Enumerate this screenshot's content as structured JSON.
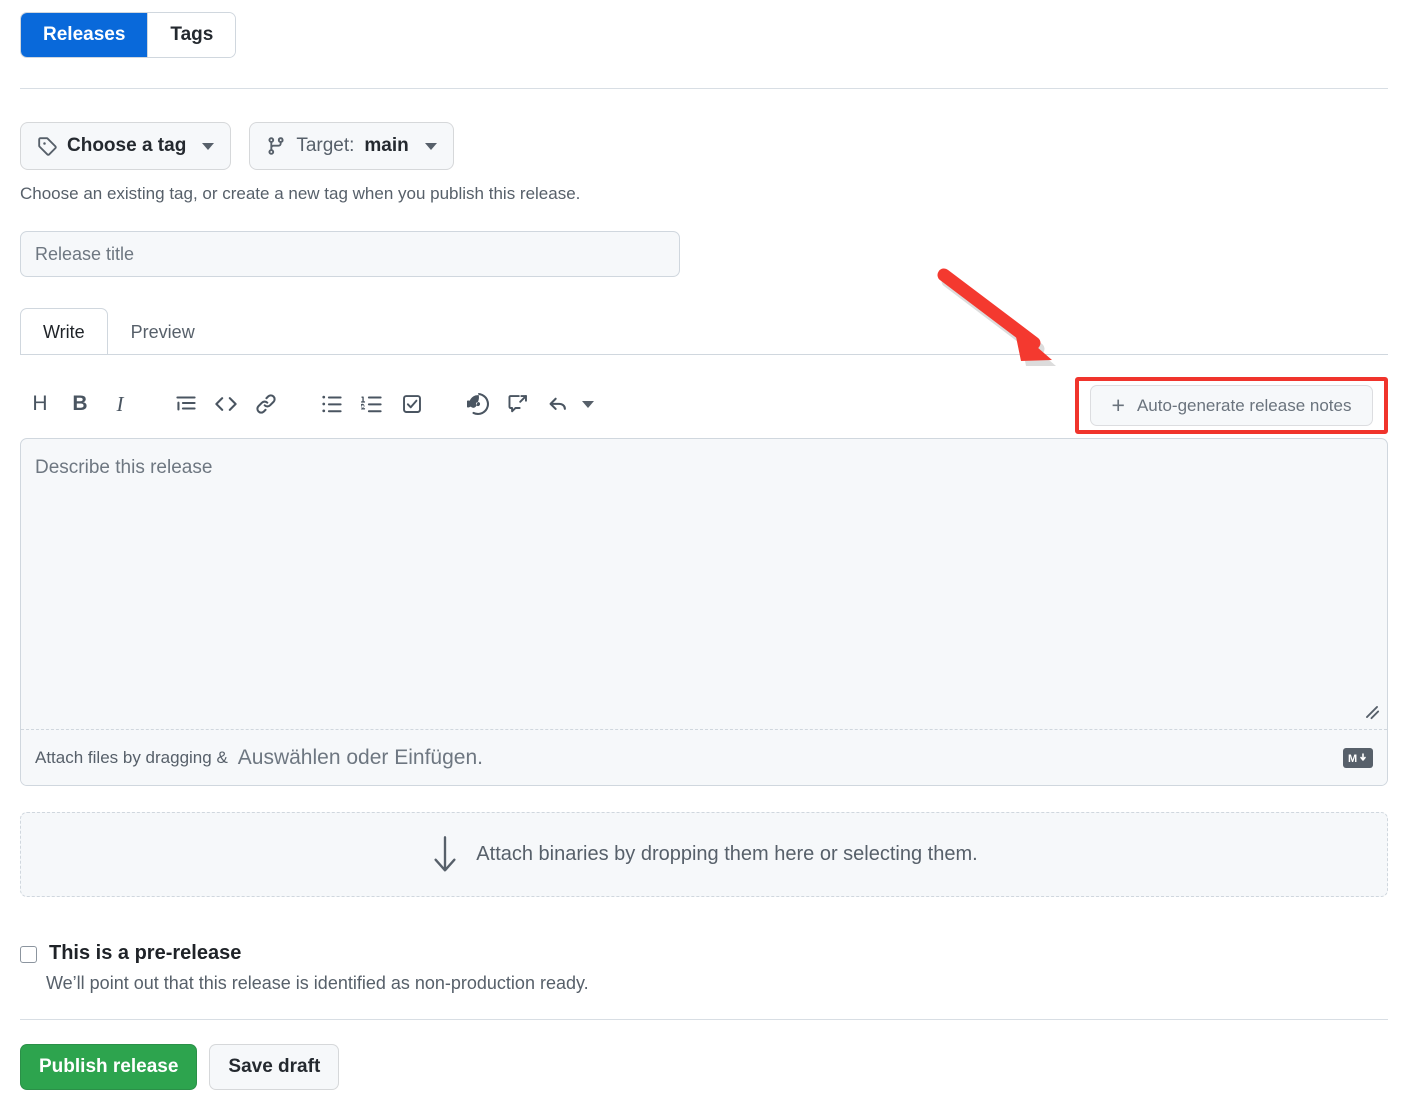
{
  "tabs": {
    "releases": "Releases",
    "tags": "Tags"
  },
  "selectors": {
    "choose_tag": "Choose a tag",
    "target_label": "Target:",
    "target_value": "main",
    "tag_icon": "tag-icon",
    "branch_icon": "git-branch-icon"
  },
  "hint": "Choose an existing tag, or create a new tag when you publish this release.",
  "title_field": {
    "placeholder": "Release title",
    "value": ""
  },
  "editor_tabs": {
    "write": "Write",
    "preview": "Preview"
  },
  "toolbar": {
    "items": [
      {
        "name": "heading-icon",
        "glyph": "H"
      },
      {
        "name": "bold-icon",
        "glyph": "B"
      },
      {
        "name": "italic-icon",
        "glyph": "I"
      },
      {
        "name": "quote-icon",
        "glyph": "quote"
      },
      {
        "name": "code-icon",
        "glyph": "<>"
      },
      {
        "name": "link-icon",
        "glyph": "link"
      },
      {
        "name": "unordered-list-icon",
        "glyph": "ul"
      },
      {
        "name": "ordered-list-icon",
        "glyph": "ol"
      },
      {
        "name": "task-list-icon",
        "glyph": "task"
      },
      {
        "name": "mention-icon",
        "glyph": "@"
      },
      {
        "name": "reference-icon",
        "glyph": "ref"
      },
      {
        "name": "reply-icon",
        "glyph": "reply"
      }
    ]
  },
  "autogen": {
    "label": "Auto-generate release notes",
    "plus": "+",
    "highlight_color": "#f0342c"
  },
  "description": {
    "placeholder": "Describe this release",
    "value": ""
  },
  "attach_footer": {
    "english_part": "Attach files by dragging &",
    "german_part": "Auswählen oder Einfügen.",
    "markdown_badge": "M"
  },
  "dropzone": {
    "text": "Attach binaries by dropping them here or selecting them.",
    "icon": "arrow-down-icon"
  },
  "prerelease": {
    "label": "This is a pre-release",
    "description": "We’ll point out that this release is identified as non-production ready.",
    "checked": false
  },
  "actions": {
    "publish": "Publish release",
    "save_draft": "Save draft"
  },
  "colors": {
    "accent_blue": "#0969da",
    "green": "#2da44e",
    "annotation_red": "#f0342c"
  }
}
